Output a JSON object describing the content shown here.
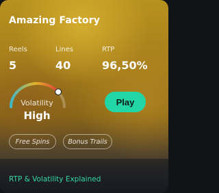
{
  "game": {
    "title": "Amazing Factory",
    "stats": [
      {
        "label": "Reels",
        "value": "5"
      },
      {
        "label": "Lines",
        "value": "40"
      },
      {
        "label": "RTP",
        "value": "96,50%"
      }
    ],
    "volatility": {
      "label": "Volatility",
      "value": "High",
      "level": 0.78
    },
    "play_label": "Play",
    "tags": [
      "Free Spins",
      "Bonus Trails"
    ],
    "footer_link": "RTP & Volatility Explained"
  },
  "colors": {
    "accent": "#22d6a5",
    "link": "#35d7a6",
    "gauge_low": "#3fb7c8",
    "gauge_mid": "#e4b62a",
    "gauge_high": "#d9403a"
  }
}
